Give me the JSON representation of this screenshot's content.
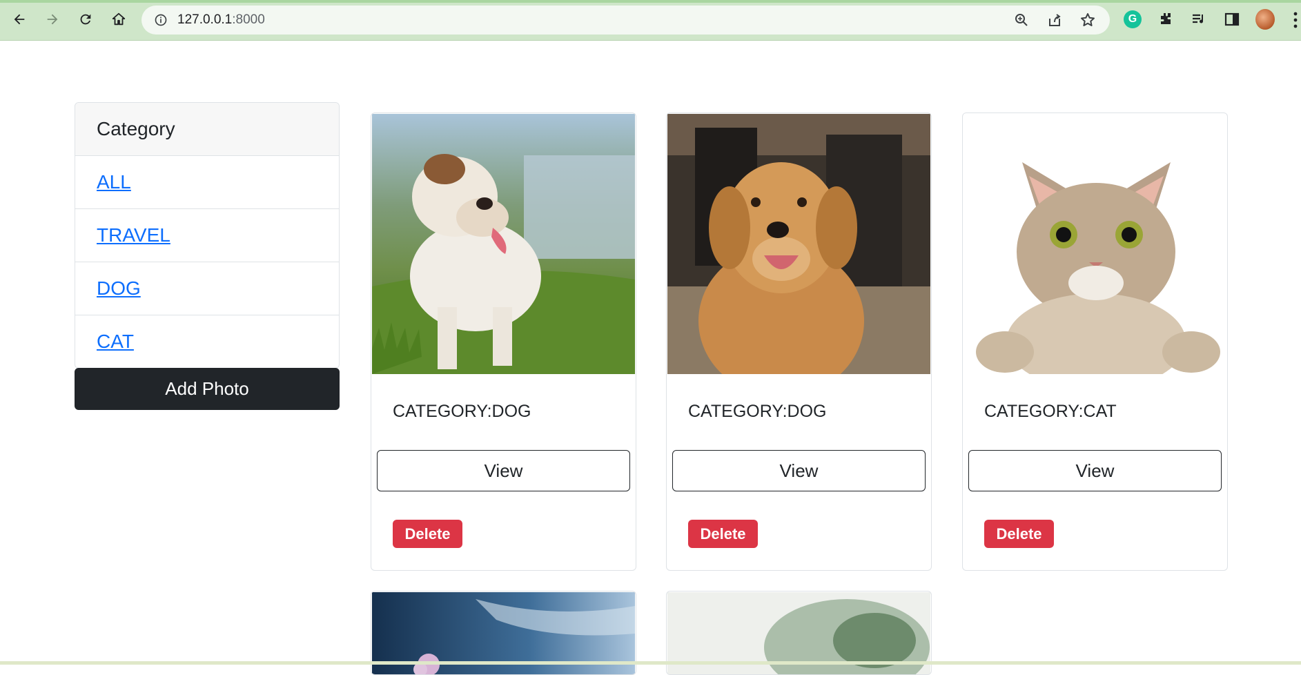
{
  "browser": {
    "url_host": "127.0.0.1",
    "url_port": ":8000",
    "icons": [
      "back-icon",
      "forward-icon",
      "reload-icon",
      "home-icon",
      "info-icon",
      "zoom-icon",
      "share-icon",
      "star-icon",
      "grammarly-icon",
      "extensions-icon",
      "reading-list-icon",
      "side-panel-icon",
      "profile-avatar",
      "menu-icon"
    ],
    "grammarly_letter": "G"
  },
  "sidebar": {
    "header": "Category",
    "items": [
      {
        "label": "ALL"
      },
      {
        "label": "TRAVEL"
      },
      {
        "label": "DOG"
      },
      {
        "label": "CAT"
      }
    ],
    "add_photo_label": "Add Photo"
  },
  "cards": [
    {
      "category_text": "CATEGORY:DOG",
      "view_label": "View",
      "delete_label": "Delete",
      "image": "bulldog"
    },
    {
      "category_text": "CATEGORY:DOG",
      "view_label": "View",
      "delete_label": "Delete",
      "image": "golden-retriever"
    },
    {
      "category_text": "CATEGORY:CAT",
      "view_label": "View",
      "delete_label": "Delete",
      "image": "tabby-cat"
    }
  ],
  "partial_cards": [
    {
      "image": "sky-flowers"
    },
    {
      "image": "blurred-plant"
    }
  ],
  "colors": {
    "link": "#0d6efd",
    "dark_button": "#212529",
    "danger": "#dc3545",
    "chrome_bg": "#cfe6c9"
  }
}
